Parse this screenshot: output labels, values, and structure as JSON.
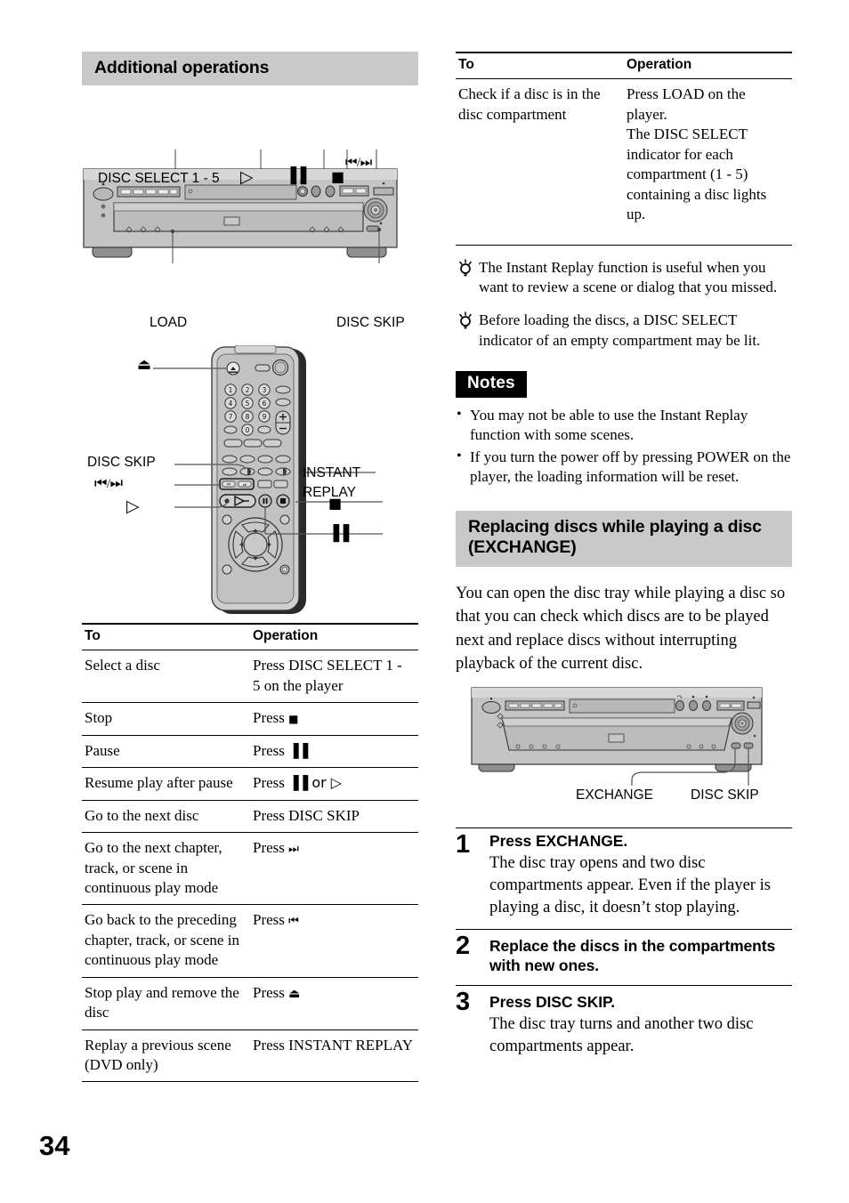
{
  "page": {
    "number": "34"
  },
  "left": {
    "section_title": "Additional operations",
    "player_diagram": {
      "labels": {
        "disc_select": "DISC SELECT 1 - 5",
        "play_symbol": "▷",
        "pause_symbol": "▐▐",
        "stop_symbol": "■",
        "skip_symbol": "⏮⏭",
        "load": "LOAD",
        "disc_skip": "DISC SKIP"
      }
    },
    "remote_diagram": {
      "labels": {
        "eject": "⏏",
        "disc_skip": "DISC SKIP",
        "skip": "⏮ / ⏭",
        "play": "▷",
        "instant_replay_line1": "INSTANT",
        "instant_replay_line2": "REPLAY",
        "stop": "■",
        "pause": "▐▐"
      },
      "keypad": [
        "1",
        "2",
        "3",
        "4",
        "5",
        "6",
        "7",
        "8",
        "9",
        "0"
      ],
      "volume": {
        "plus": "+",
        "minus": "−"
      }
    },
    "table": {
      "headers": {
        "to": "To",
        "operation": "Operation"
      },
      "rows": [
        {
          "to": "Select a disc",
          "op_pre": "Press DISC SELECT 1 - 5 on the player",
          "op_glyph": "",
          "op_post": ""
        },
        {
          "to": "Stop",
          "op_pre": "Press ",
          "op_glyph": "■",
          "op_post": ""
        },
        {
          "to": "Pause",
          "op_pre": "Press ",
          "op_glyph": "▐▐",
          "op_post": ""
        },
        {
          "to": "Resume play after pause",
          "op_pre": "Press ",
          "op_glyph": "▐▐",
          "op_post": " or ▷"
        },
        {
          "to": "Go to the next disc",
          "op_pre": "Press DISC SKIP",
          "op_glyph": "",
          "op_post": ""
        },
        {
          "to": "Go to the next chapter, track, or scene in continuous play mode",
          "op_pre": "Press ",
          "op_glyph": "⏭",
          "op_post": ""
        },
        {
          "to": "Go back to the preceding chapter, track, or scene in continuous play mode",
          "op_pre": "Press ",
          "op_glyph": "⏮",
          "op_post": ""
        },
        {
          "to": "Stop play and remove the disc",
          "op_pre": "Press ",
          "op_glyph": "⏏",
          "op_post": ""
        },
        {
          "to": "Replay a previous scene (DVD only)",
          "op_pre": "Press INSTANT REPLAY",
          "op_glyph": "",
          "op_post": ""
        }
      ]
    }
  },
  "right": {
    "table": {
      "headers": {
        "to": "To",
        "operation": "Operation"
      },
      "rows": [
        {
          "to": "Check if a disc is in the disc compartment",
          "op": "Press LOAD on the player.\nThe DISC SELECT indicator for each compartment (1 - 5) containing a disc lights up."
        }
      ]
    },
    "tips": [
      "The Instant Replay function is useful when you want to review a scene or dialog that you missed.",
      "Before loading the discs, a DISC SELECT indicator of an empty compartment may be lit."
    ],
    "notes": {
      "badge": "Notes",
      "items": [
        "You may not be able to use the Instant Replay function with some scenes.",
        "If you turn the power off by pressing POWER on the player, the loading information will be reset."
      ]
    },
    "section_title_line1": "Replacing discs while playing a disc",
    "section_title_line2": "(EXCHANGE)",
    "intro": "You can open the disc tray while playing a disc so that you can check which discs are to be played next and replace discs without interrupting playback of the current disc.",
    "player_diagram": {
      "labels": {
        "exchange": "EXCHANGE",
        "disc_skip": "DISC SKIP"
      }
    },
    "steps": [
      {
        "num": "1",
        "title": "Press EXCHANGE.",
        "body": "The disc tray opens and two disc compartments appear. Even if the player is playing a disc, it doesn’t stop playing."
      },
      {
        "num": "2",
        "title": "Replace the discs in the compartments with new ones.",
        "body": ""
      },
      {
        "num": "3",
        "title": "Press DISC SKIP.",
        "body": "The disc tray turns and another two disc compartments appear."
      }
    ]
  },
  "colors": {
    "section_bg": "#c9c9c9",
    "notes_bg": "#000000",
    "rule": "#000000"
  }
}
